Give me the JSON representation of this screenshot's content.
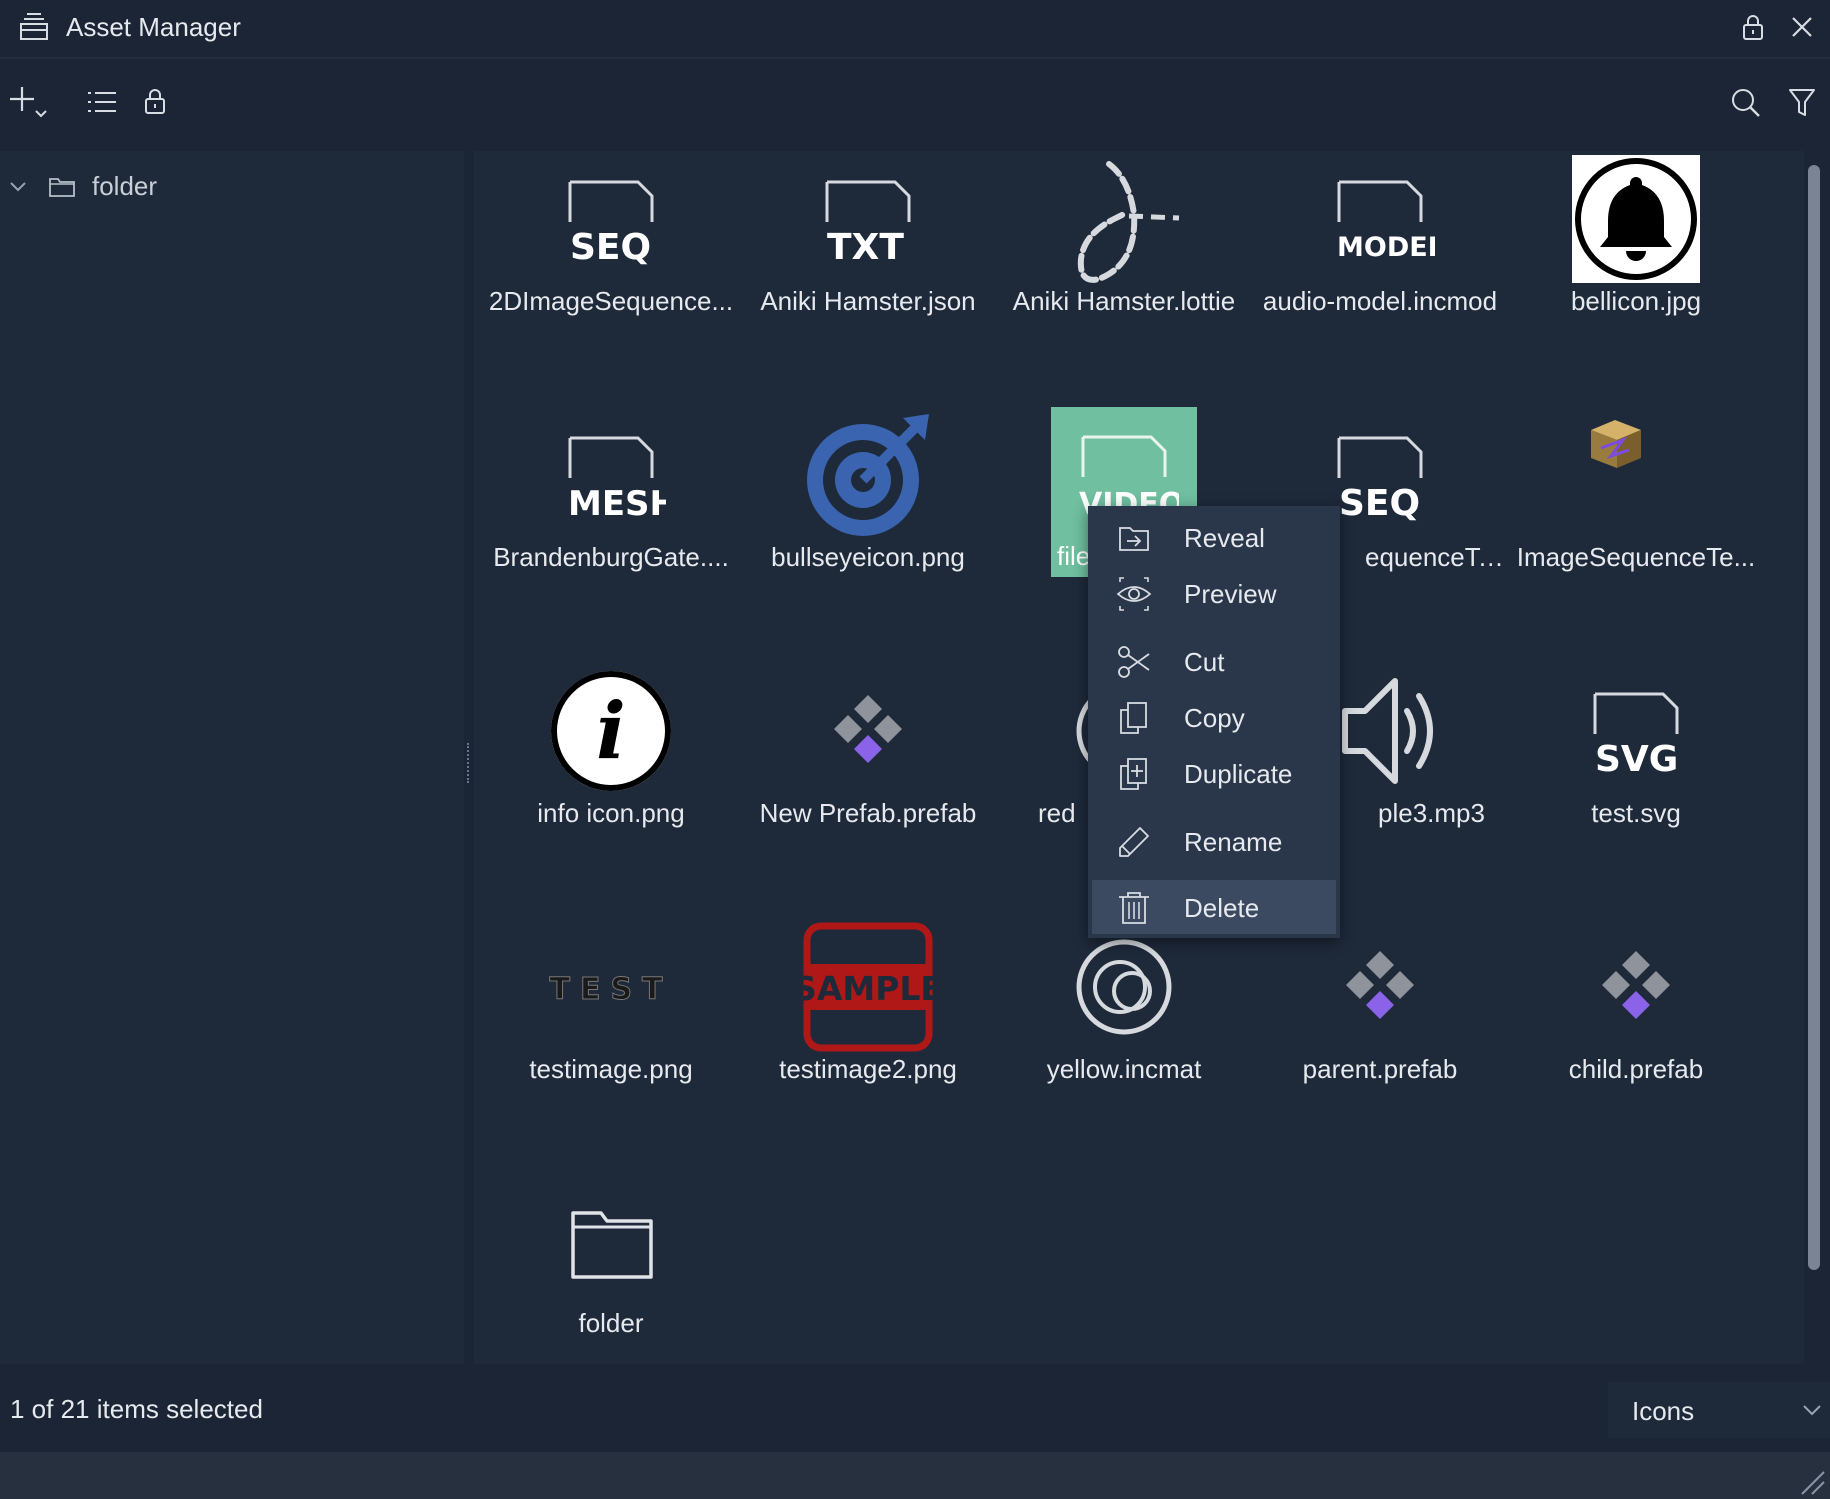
{
  "window": {
    "title": "Asset Manager",
    "icon": "asset-manager-icon"
  },
  "toolbar": {
    "left_icons": [
      "add-icon",
      "list-view-icon",
      "lock-icon"
    ],
    "right_icons": [
      "search-icon",
      "filter-icon"
    ]
  },
  "tree": {
    "items": [
      {
        "label": "folder",
        "expanded": true,
        "icon": "folder-icon"
      }
    ]
  },
  "assets": [
    {
      "label": "2DImageSequence...",
      "kind": "SEQ"
    },
    {
      "label": "Aniki Hamster.json",
      "kind": "TXT"
    },
    {
      "label": "Aniki Hamster.lottie",
      "kind": "lottie"
    },
    {
      "label": "audio-model.incmod",
      "kind": "MODEL"
    },
    {
      "label": "bellicon.jpg",
      "kind": "bell"
    },
    {
      "label": "BrandenburgGate....",
      "kind": "MESH"
    },
    {
      "label": "bullseyeicon.png",
      "kind": "bullseye"
    },
    {
      "label": "file",
      "kind": "VIDEO"
    },
    {
      "label": "equenceTe...",
      "kind": "SEQ"
    },
    {
      "label": "ImageSequenceTe...",
      "kind": "cube"
    },
    {
      "label": "info icon.png",
      "kind": "info"
    },
    {
      "label": "New Prefab.prefab",
      "kind": "prefab"
    },
    {
      "label": "red",
      "kind": "material"
    },
    {
      "label": "ple3.mp3",
      "kind": "audio"
    },
    {
      "label": "test.svg",
      "kind": "SVG"
    },
    {
      "label": "testimage.png",
      "kind": "test"
    },
    {
      "label": "testimage2.png",
      "kind": "sample"
    },
    {
      "label": "yellow.incmat",
      "kind": "material"
    },
    {
      "label": "parent.prefab",
      "kind": "prefab"
    },
    {
      "label": "child.prefab",
      "kind": "prefab"
    },
    {
      "label": "folder",
      "kind": "folder"
    }
  ],
  "thumb_text": {
    "seq": "SEQ",
    "txt": "TXT",
    "model": "MODEL",
    "mesh": "MESH",
    "video": "VIDEO",
    "svg": "SVG",
    "test": "TEST",
    "sample": "SAMPLE",
    "info": "i"
  },
  "context_menu": {
    "items": [
      {
        "label": "Reveal",
        "icon": "reveal-icon"
      },
      {
        "label": "Preview",
        "icon": "eye-icon"
      },
      {
        "label": "Cut",
        "icon": "scissors-icon"
      },
      {
        "label": "Copy",
        "icon": "copy-icon"
      },
      {
        "label": "Duplicate",
        "icon": "duplicate-icon"
      },
      {
        "label": "Rename",
        "icon": "pencil-icon"
      },
      {
        "label": "Delete",
        "icon": "trash-icon"
      }
    ],
    "hovered": "Delete"
  },
  "status": {
    "selection": "1 of 21 items selected"
  },
  "view_mode": {
    "selected": "Icons"
  },
  "colors": {
    "background": "#1c2535",
    "panel": "#1e293a",
    "selection": "#6fbfa0",
    "menu": "#2a3649",
    "menu_hover": "#3b4a61",
    "prefab_accent": "#8a63e8",
    "bullseye": "#3a64b0"
  }
}
